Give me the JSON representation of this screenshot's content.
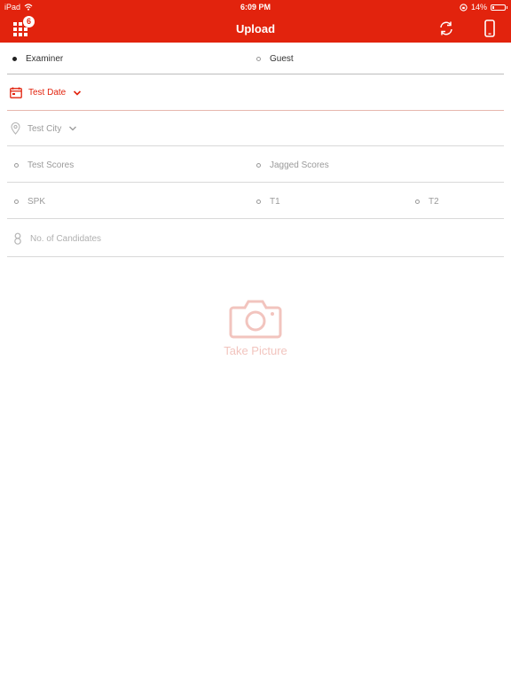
{
  "status_bar": {
    "device": "iPad",
    "time": "6:09 PM",
    "battery": "14%",
    "battery_level": 0.14
  },
  "header": {
    "title": "Upload",
    "badge_count": "6",
    "color": "#e2230d"
  },
  "role": {
    "options": [
      "Examiner",
      "Guest"
    ],
    "selected": "Examiner"
  },
  "test_date": {
    "label": "Test Date"
  },
  "test_city": {
    "label": "Test City"
  },
  "scores": {
    "options": [
      "Test Scores",
      "Jagged Scores"
    ]
  },
  "section": {
    "options": [
      "SPK",
      "T1",
      "T2"
    ]
  },
  "candidates": {
    "placeholder": "No. of Candidates"
  },
  "camera": {
    "label": "Take Picture"
  }
}
